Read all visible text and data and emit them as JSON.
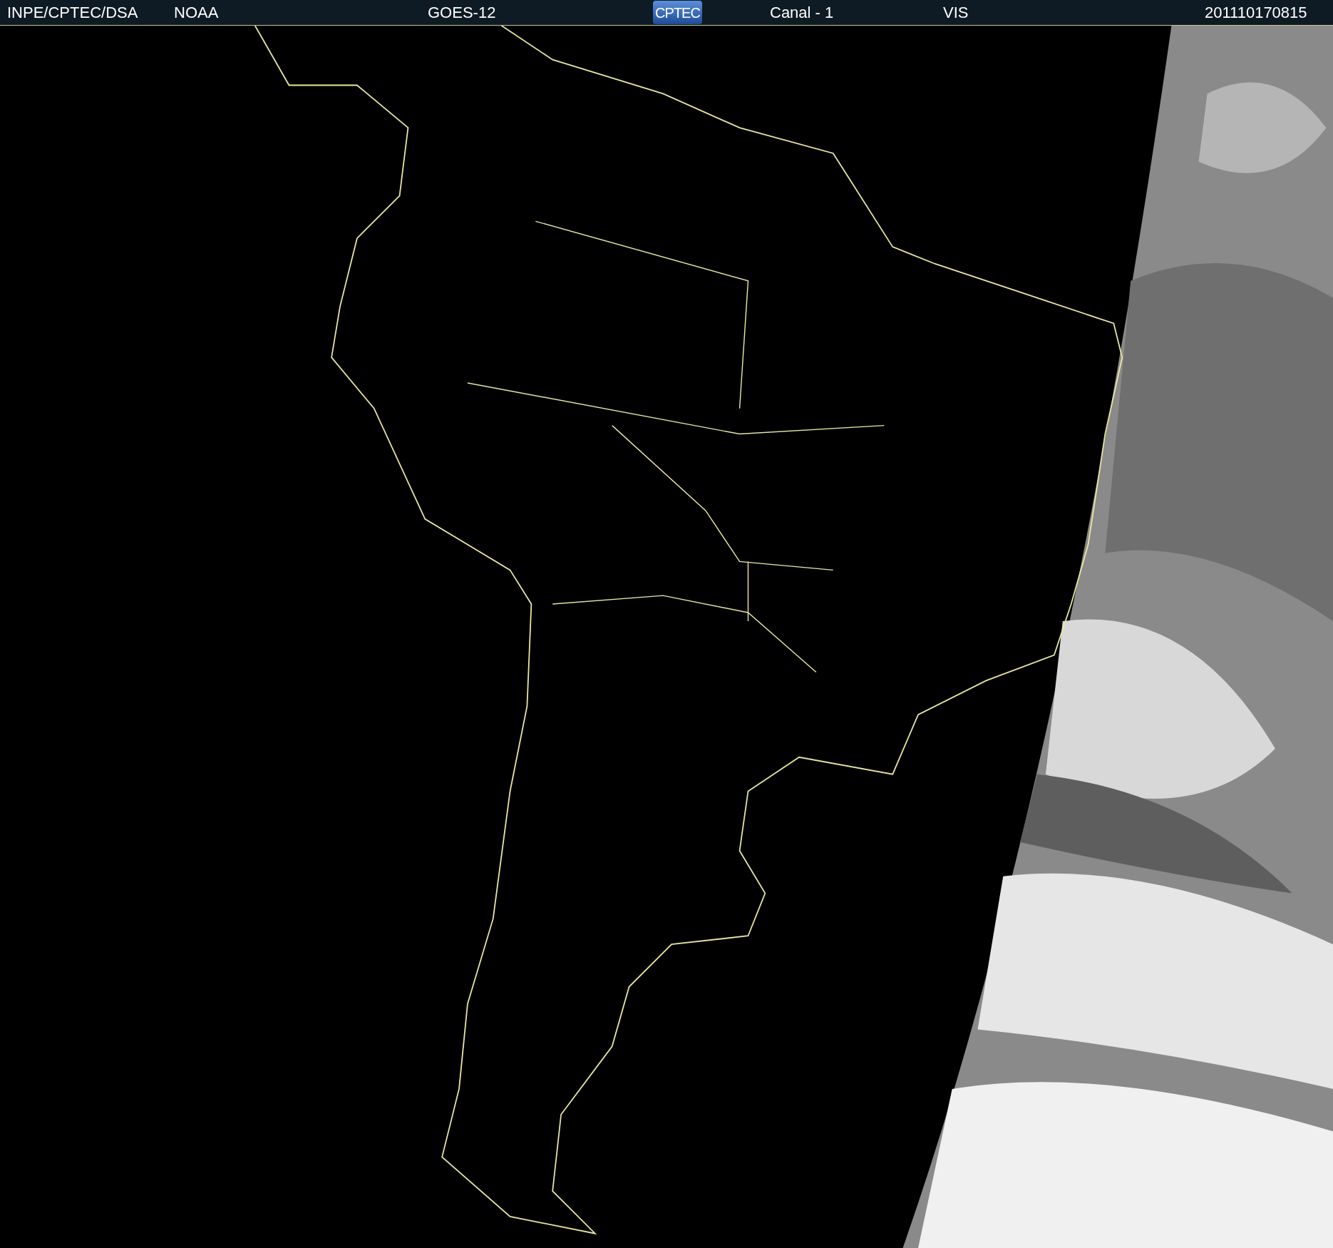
{
  "header": {
    "source": "INPE/CPTEC/DSA",
    "agency": "NOAA",
    "satellite": "GOES-12",
    "logo": "CPTEC",
    "channel": "Canal - 1",
    "band": "VIS",
    "timestamp": "201110170815"
  }
}
